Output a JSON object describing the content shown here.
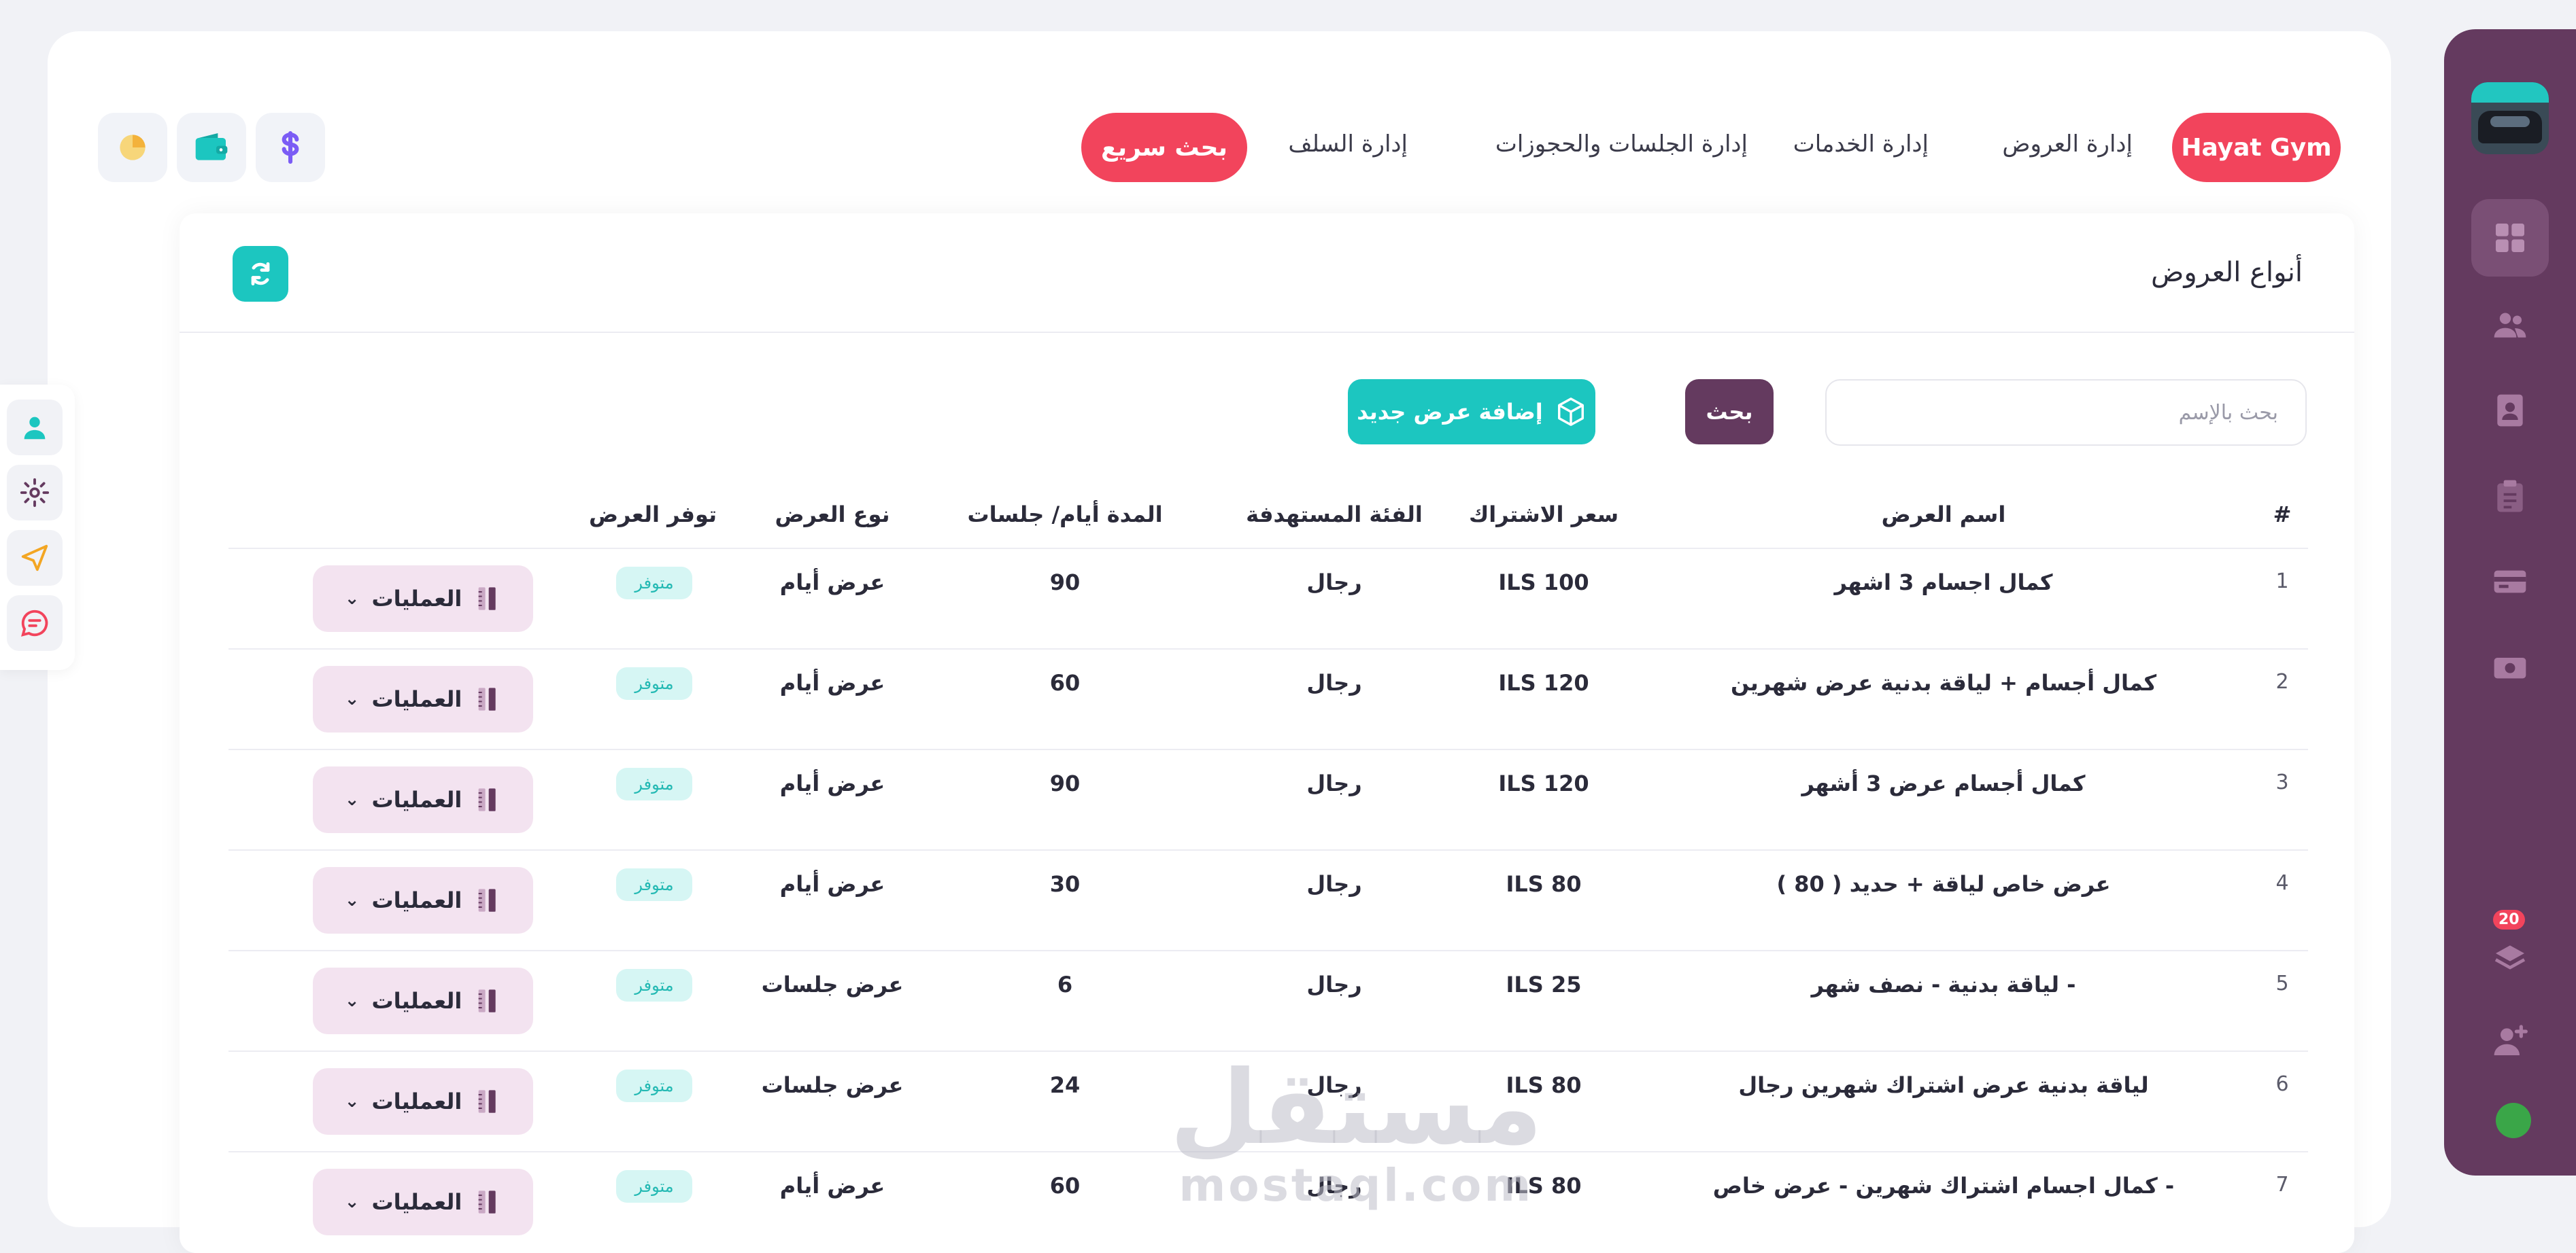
{
  "nav": {
    "brand": "Hayat Gym",
    "links": [
      "إدارة العروض",
      "إدارة الخدمات",
      "إدارة الجلسات والحجوزات",
      "إدارة السلف"
    ],
    "quick_search": "بحث سريع"
  },
  "topbar_icons": [
    "dollar-icon",
    "wallet-icon",
    "pie-chart-icon"
  ],
  "panel": {
    "title": "أنواع العروض",
    "search_placeholder": "بحث بالإسم",
    "search_button": "بحث",
    "add_button": "إضافة عرض جديد"
  },
  "table": {
    "columns": {
      "index": "#",
      "name": "اسم العرض",
      "price": "سعر الاشتراك",
      "category": "الفئة المستهدفة",
      "duration": "المدة أيام/ جلسات",
      "type": "نوع العرض",
      "availability": "توفر العرض"
    },
    "actions_label": "العمليات",
    "rows": [
      {
        "index": "1",
        "name": "كمال اجسام 3 اشهر",
        "price": "ILS 100",
        "category": "رجال",
        "duration": "90",
        "type": "عرض أيام",
        "availability": "متوفر"
      },
      {
        "index": "2",
        "name": "كمال أجسام + لياقة بدنية عرض شهرين",
        "price": "ILS 120",
        "category": "رجال",
        "duration": "60",
        "type": "عرض أيام",
        "availability": "متوفر"
      },
      {
        "index": "3",
        "name": "كمال أجسام عرض 3 أشهر",
        "price": "ILS 120",
        "category": "رجال",
        "duration": "90",
        "type": "عرض أيام",
        "availability": "متوفر"
      },
      {
        "index": "4",
        "name": "عرض خاص لياقة + حديد ( 80 )",
        "price": "ILS 80",
        "category": "رجال",
        "duration": "30",
        "type": "عرض أيام",
        "availability": "متوفر"
      },
      {
        "index": "5",
        "name": "لياقة بدنية - نصف شهر -",
        "price": "ILS 25",
        "category": "رجال",
        "duration": "6",
        "type": "عرض جلسات",
        "availability": "متوفر"
      },
      {
        "index": "6",
        "name": "لياقة بدنية عرض اشتراك شهرين رجال",
        "price": "ILS 80",
        "category": "رجال",
        "duration": "24",
        "type": "عرض جلسات",
        "availability": "متوفر"
      },
      {
        "index": "7",
        "name": "كمال اجسام اشتراك شهرين - عرض خاص -",
        "price": "ILS 80",
        "category": "رجال",
        "duration": "60",
        "type": "عرض أيام",
        "availability": "متوفر"
      }
    ]
  },
  "sidebar": {
    "notification_count": "20"
  },
  "watermark": {
    "arabic": "مستقل",
    "latin": "mostaql.com"
  },
  "colors": {
    "brand_red": "#f2445c",
    "sidebar_purple": "#643a5f",
    "teal": "#1cc6c0",
    "ops_pink": "#f3e3f0"
  }
}
